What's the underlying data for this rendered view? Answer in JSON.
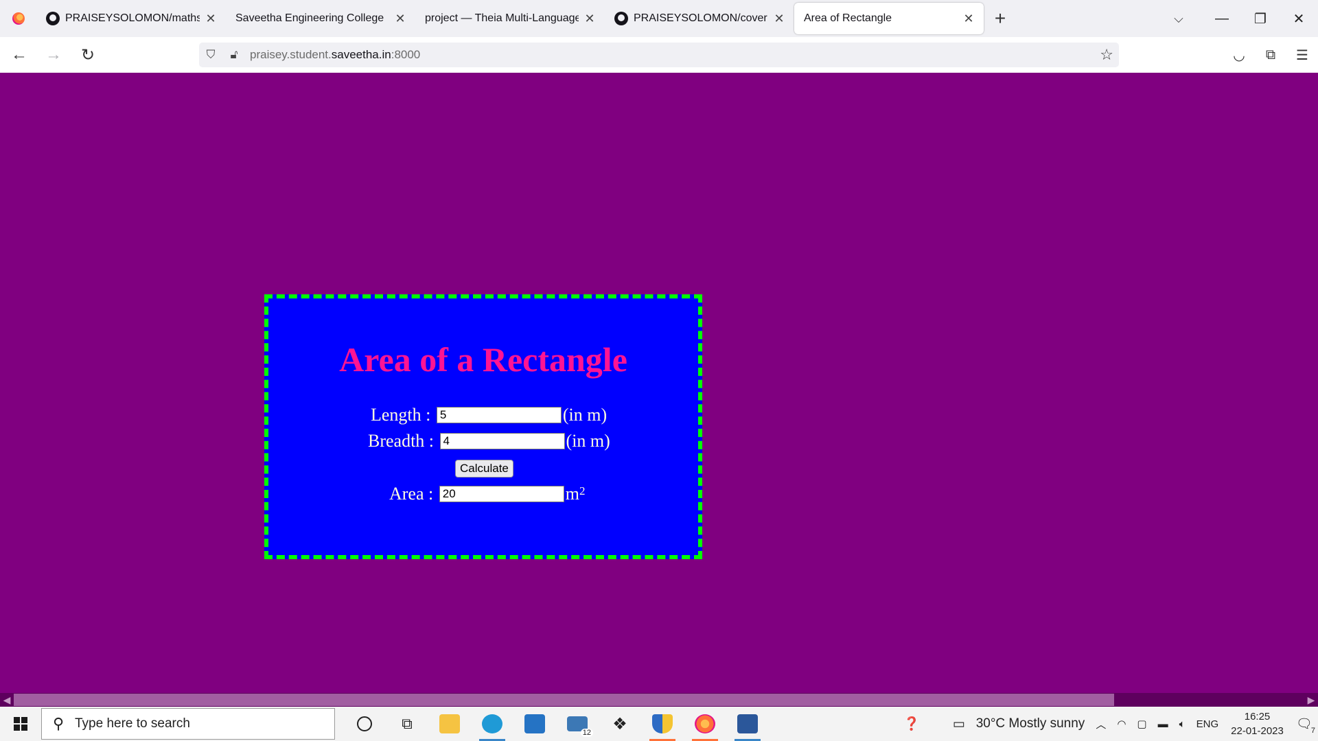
{
  "browser": {
    "tabs": [
      {
        "label": "PRAISEYSOLOMON/mathserver",
        "icon": "github-icon",
        "active": false
      },
      {
        "label": "Saveetha Engineering College",
        "icon": "",
        "active": false
      },
      {
        "label": "project — Theia Multi-Language Ex",
        "icon": "",
        "active": false
      },
      {
        "label": "PRAISEYSOLOMON/cover",
        "icon": "github-icon",
        "active": false
      },
      {
        "label": "Area of Rectangle",
        "icon": "",
        "active": true
      }
    ],
    "url_prefix": "praisey.student.",
    "url_host": "saveetha.in",
    "url_suffix": ":8000"
  },
  "page": {
    "background": "#800080",
    "card_background": "#0000ff",
    "border_color": "#00ff00",
    "title": "Area of a Rectangle",
    "title_color": "#ff1493",
    "length_label": "Length :",
    "length_value": "5",
    "length_unit": "(in m)",
    "breadth_label": "Breadth :",
    "breadth_value": "4",
    "breadth_unit": "(in m)",
    "calculate_label": "Calculate",
    "area_label": "Area :",
    "area_value": "20",
    "area_unit": "m",
    "area_unit_sup": "2"
  },
  "taskbar": {
    "search_placeholder": "Type here to search",
    "mail_badge": "12",
    "weather": "30°C  Mostly sunny",
    "language": "ENG",
    "time": "16:25",
    "date": "22-01-2023",
    "notifications": "7"
  }
}
